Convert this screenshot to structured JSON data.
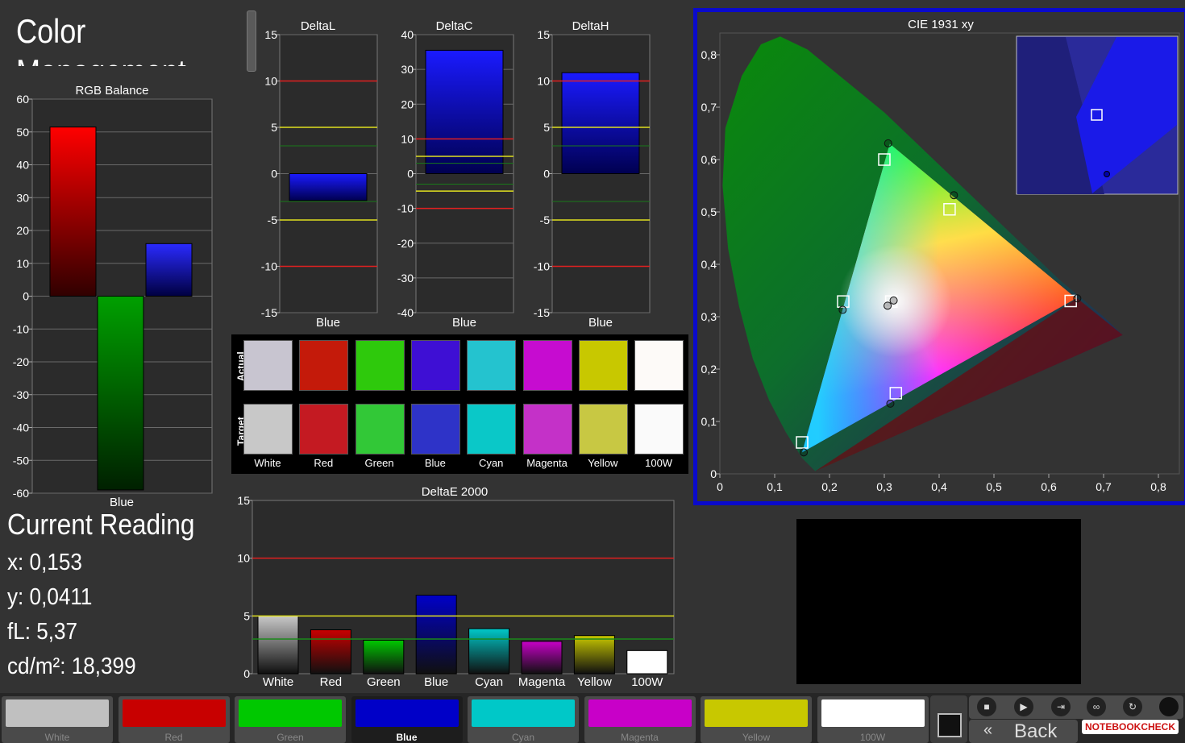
{
  "header": {
    "title": "Color Management"
  },
  "current_reading": {
    "title": "Current Reading",
    "x": "x: 0,153",
    "y": "y: 0,0411",
    "fl": "fL: 5,37",
    "cd": "cd/m²: 18,399"
  },
  "swatches": {
    "actual_label": "Actual",
    "target_label": "Target",
    "items": [
      {
        "name": "White",
        "actual": "#c8c5d0",
        "target": "#c8c8c8"
      },
      {
        "name": "Red",
        "actual": "#c41a0a",
        "target": "#c41a22"
      },
      {
        "name": "Green",
        "actual": "#2ec90c",
        "target": "#32c837"
      },
      {
        "name": "Blue",
        "actual": "#3e0fd4",
        "target": "#2e33c8"
      },
      {
        "name": "Cyan",
        "actual": "#24c3cf",
        "target": "#0ac8c8"
      },
      {
        "name": "Magenta",
        "actual": "#c60cd0",
        "target": "#c431c8"
      },
      {
        "name": "Yellow",
        "actual": "#c8c800",
        "target": "#c8c843"
      },
      {
        "name": "100W",
        "actual": "#fdfaf8",
        "target": "#fafafa"
      }
    ]
  },
  "bottom_bar": {
    "buttons": [
      {
        "label": "White",
        "color": "#c0c0c0"
      },
      {
        "label": "Red",
        "color": "#c80000"
      },
      {
        "label": "Green",
        "color": "#00c800"
      },
      {
        "label": "Blue",
        "color": "#0000c8"
      },
      {
        "label": "Cyan",
        "color": "#00c8c8"
      },
      {
        "label": "Magenta",
        "color": "#c800c8"
      },
      {
        "label": "Yellow",
        "color": "#c8c800"
      },
      {
        "label": "100W",
        "color": "#ffffff"
      }
    ],
    "active": "Blue",
    "back_label": "Back",
    "watermark": "NOTEBOOKCHECK"
  },
  "chart_data": [
    {
      "type": "bar",
      "title": "RGB Balance",
      "xlabel": "Blue",
      "ylim": [
        -60,
        60
      ],
      "ticks": [
        60,
        50,
        40,
        30,
        20,
        10,
        0,
        -10,
        -20,
        -30,
        -40,
        -50,
        -60
      ],
      "series": [
        {
          "name": "Red",
          "value": 51.5,
          "color": "#ff0000"
        },
        {
          "name": "Green",
          "value": -59,
          "color": "#00a000"
        },
        {
          "name": "Blue",
          "value": 16,
          "color": "#0000ff"
        }
      ]
    },
    {
      "type": "bar",
      "title": "DeltaL",
      "xlabel": "Blue",
      "ylim": [
        -15,
        15
      ],
      "ticks": [
        15,
        10,
        5,
        0,
        -5,
        -10,
        -15
      ],
      "value": -2.9
    },
    {
      "type": "bar",
      "title": "DeltaC",
      "xlabel": "Blue",
      "ylim": [
        -40,
        40
      ],
      "ticks": [
        40,
        30,
        20,
        10,
        0,
        -10,
        -20,
        -30,
        -40
      ],
      "value": 35.5
    },
    {
      "type": "bar",
      "title": "DeltaH",
      "xlabel": "Blue",
      "ylim": [
        -15,
        15
      ],
      "ticks": [
        15,
        10,
        5,
        0,
        -5,
        -10,
        -15
      ],
      "value": 10.9
    },
    {
      "type": "bar",
      "title": "DeltaE 2000",
      "ylim": [
        0,
        15
      ],
      "ticks": [
        15,
        10,
        5,
        0
      ],
      "categories": [
        "White",
        "Red",
        "Green",
        "Blue",
        "Cyan",
        "Magenta",
        "Yellow",
        "100W"
      ],
      "values": [
        5.0,
        3.8,
        2.9,
        6.8,
        3.9,
        2.8,
        3.3,
        2.0
      ],
      "colors": [
        "#c8c8c8",
        "#c80000",
        "#00c800",
        "#0000c8",
        "#00c8c8",
        "#c800c8",
        "#c8c800",
        "#ffffff"
      ]
    },
    {
      "type": "scatter",
      "title": "CIE 1931 xy",
      "xlim": [
        0,
        0.8
      ],
      "ylim": [
        0,
        0.8
      ],
      "xticks": [
        "0",
        "0,1",
        "0,2",
        "0,3",
        "0,4",
        "0,5",
        "0,6",
        "0,7",
        "0,8"
      ],
      "yticks": [
        "0",
        "0,1",
        "0,2",
        "0,3",
        "0,4",
        "0,5",
        "0,6",
        "0,7",
        "0,8"
      ],
      "gamut_actual": [
        [
          0.65,
          0.335
        ],
        [
          0.31,
          0.63
        ],
        [
          0.15,
          0.041
        ]
      ],
      "targets": [
        [
          0.64,
          0.33
        ],
        [
          0.3,
          0.6
        ],
        [
          0.15,
          0.06
        ],
        [
          0.225,
          0.329
        ],
        [
          0.321,
          0.154
        ],
        [
          0.419,
          0.505
        ],
        [
          0.3127,
          0.329
        ],
        [
          0.3127,
          0.329
        ]
      ],
      "actuals": [
        [
          0.652,
          0.335
        ],
        [
          0.307,
          0.631
        ],
        [
          0.153,
          0.041
        ],
        [
          0.224,
          0.313
        ],
        [
          0.311,
          0.134
        ],
        [
          0.427,
          0.532
        ],
        [
          0.306,
          0.321
        ],
        [
          0.317,
          0.331
        ]
      ]
    }
  ]
}
